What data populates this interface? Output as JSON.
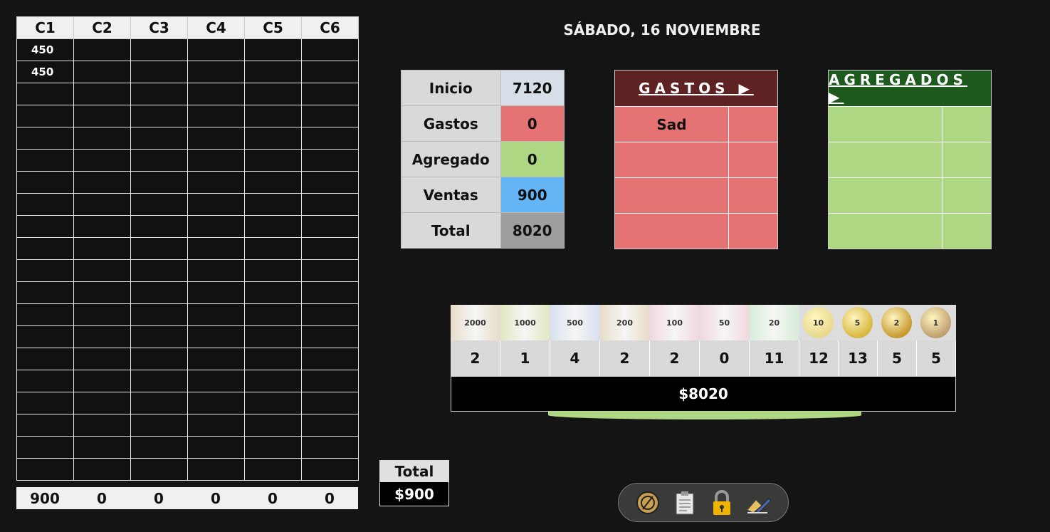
{
  "grid": {
    "headers": [
      "C1",
      "C2",
      "C3",
      "C4",
      "C5",
      "C6"
    ],
    "rows": [
      [
        "450",
        "",
        "",
        "",
        "",
        ""
      ],
      [
        "450",
        "",
        "",
        "",
        "",
        ""
      ]
    ],
    "totals": [
      "900",
      "0",
      "0",
      "0",
      "0",
      "0"
    ]
  },
  "total_box": {
    "label": "Total",
    "value": "$900"
  },
  "date": "SÁBADO, 16 NOVIEMBRE",
  "summary": [
    {
      "label": "Inicio",
      "value": "7120",
      "color": "#d6dfe8"
    },
    {
      "label": "Gastos",
      "value": "0",
      "color": "#e57373"
    },
    {
      "label": "Agregado",
      "value": "0",
      "color": "#add783"
    },
    {
      "label": "Ventas",
      "value": "900",
      "color": "#64b5f6"
    },
    {
      "label": "Total",
      "value": "8020",
      "color": "#9e9e9e"
    }
  ],
  "gastos": {
    "title": "GASTOS ▶",
    "items": [
      "Sad",
      "",
      "",
      ""
    ]
  },
  "agregados": {
    "title": "AGREGADOS ▶",
    "items": [
      "",
      "",
      "",
      ""
    ]
  },
  "money": {
    "denominations": [
      {
        "kind": "bill",
        "label": "2000",
        "color": "#e8dccc",
        "count": "2"
      },
      {
        "kind": "bill",
        "label": "1000",
        "color": "#e0e8c0",
        "count": "1"
      },
      {
        "kind": "bill",
        "label": "500",
        "color": "#d8e0f0",
        "count": "4"
      },
      {
        "kind": "bill",
        "label": "200",
        "color": "#e8dcc8",
        "count": "2"
      },
      {
        "kind": "bill",
        "label": "100",
        "color": "#f0d8e0",
        "count": "2"
      },
      {
        "kind": "bill",
        "label": "50",
        "color": "#f0d8e0",
        "count": "0"
      },
      {
        "kind": "bill",
        "label": "20",
        "color": "#d8ecd8",
        "count": "11"
      },
      {
        "kind": "coin",
        "label": "10",
        "color": "#e8d98c",
        "count": "12"
      },
      {
        "kind": "coin",
        "label": "5",
        "color": "#d8b840",
        "count": "13"
      },
      {
        "kind": "coin",
        "label": "2",
        "color": "#c89a30",
        "count": "5"
      },
      {
        "kind": "coin",
        "label": "1",
        "color": "#c0a070",
        "count": "5"
      }
    ],
    "total": "$8020"
  },
  "toolbar": [
    "coins-icon",
    "clipboard-icon",
    "lock-icon",
    "edit-icon"
  ]
}
